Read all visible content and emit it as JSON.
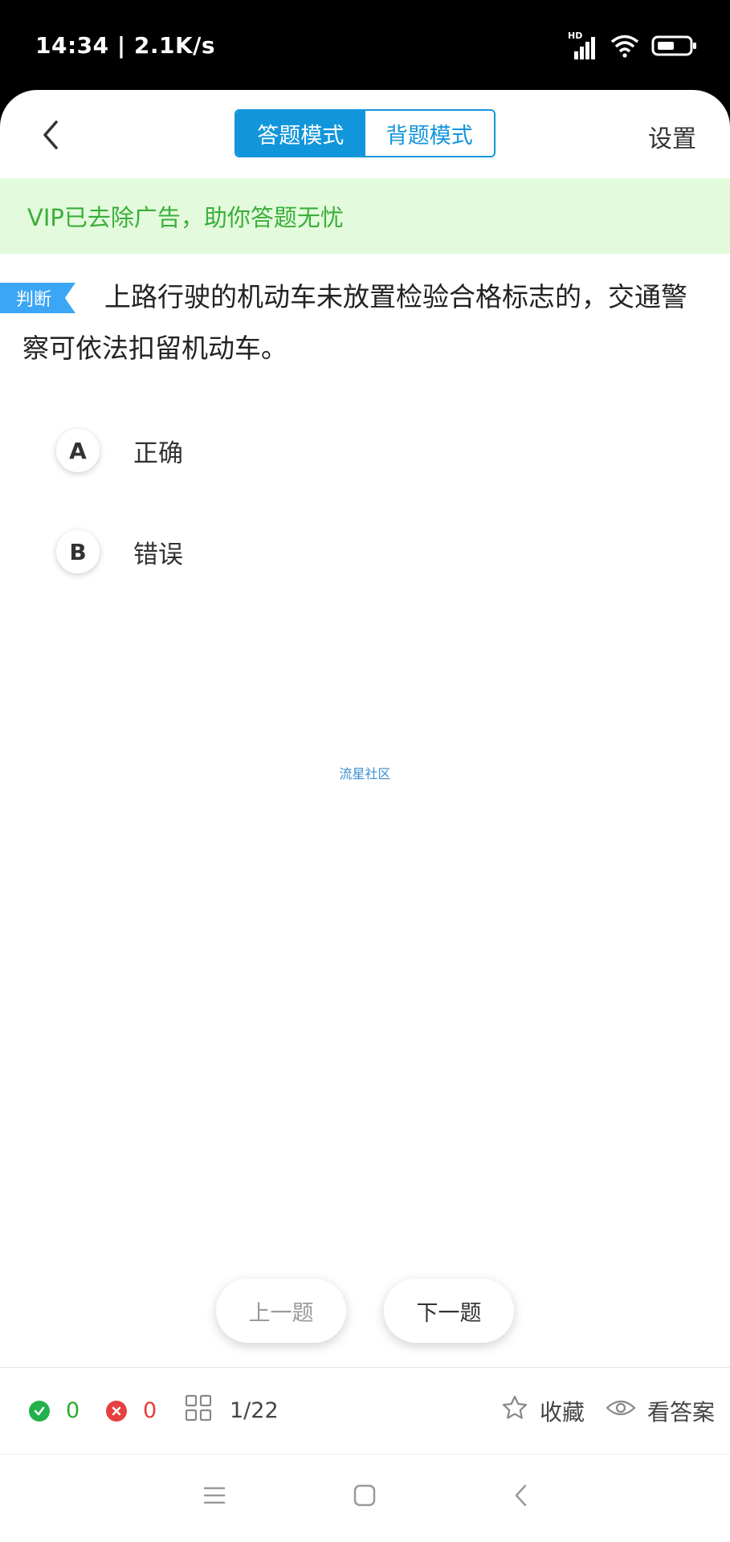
{
  "status_bar": {
    "time": "14:34 | 2.1K/s",
    "network_badge": "HD"
  },
  "header": {
    "mode_active": "答题模式",
    "mode_inactive": "背题模式",
    "settings": "设置"
  },
  "banner": {
    "text": "VIP已去除广告，助你答题无忧"
  },
  "question": {
    "type_tag": "判断",
    "text": "上路行驶的机动车未放置检验合格标志的，交通警察可依法扣留机动车。"
  },
  "options": [
    {
      "letter": "A",
      "label": "正确"
    },
    {
      "letter": "B",
      "label": "错误"
    }
  ],
  "watermark": "流星社区",
  "navigation": {
    "prev": "上一题",
    "next": "下一题"
  },
  "footer": {
    "correct_count": "0",
    "wrong_count": "0",
    "progress": "1/22",
    "favorite": "收藏",
    "view_answer": "看答案"
  },
  "colors": {
    "accent": "#1296db",
    "banner_bg": "#e3fbdc",
    "banner_text": "#3aae3a",
    "correct": "#22b14c",
    "wrong": "#e64040"
  }
}
